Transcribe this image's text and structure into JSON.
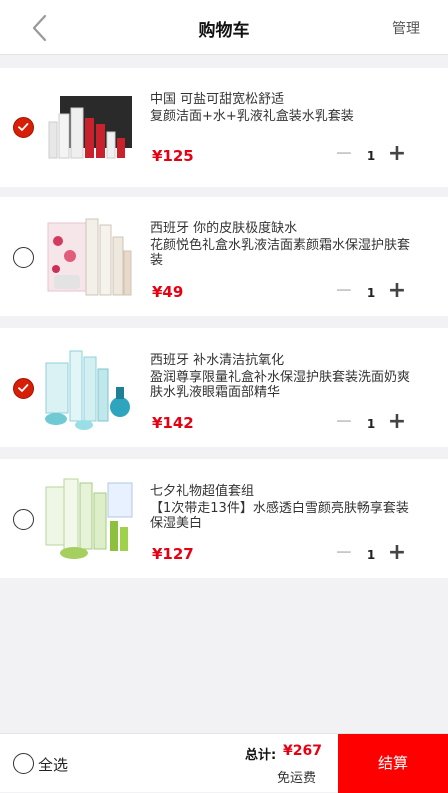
{
  "header": {
    "title": "购物车",
    "manage_label": "管理"
  },
  "currency": "¥",
  "accent_color": "#e60012",
  "checkout_color": "#ff0000",
  "items": [
    {
      "name": "中国 可盐可甜宽松舒适",
      "desc": "复颜洁面+水+乳液礼盒装水乳套装",
      "price": "¥125",
      "qty": "1",
      "selected": true
    },
    {
      "name": "西班牙 你的皮肤极度缺水",
      "desc": "花颜悦色礼盒水乳液洁面素颜霜水保湿护肤套装",
      "price": "¥49",
      "qty": "1",
      "selected": false
    },
    {
      "name": "西班牙 补水清洁抗氧化",
      "desc": "盈润尊享限量礼盒补水保湿护肤套装洗面奶爽肤水乳液眼霜面部精华",
      "price": "¥142",
      "qty": "1",
      "selected": true
    },
    {
      "name": "七夕礼物超值套组",
      "desc": "【1次带走13件】水感透白雪颜亮肤畅享套装保湿美白",
      "price": "¥127",
      "qty": "1",
      "selected": false
    }
  ],
  "footer": {
    "select_all_label": "全选",
    "total_label": "总计:",
    "total_value": "¥267",
    "shipping": "免运费",
    "checkout_label": "结算"
  }
}
